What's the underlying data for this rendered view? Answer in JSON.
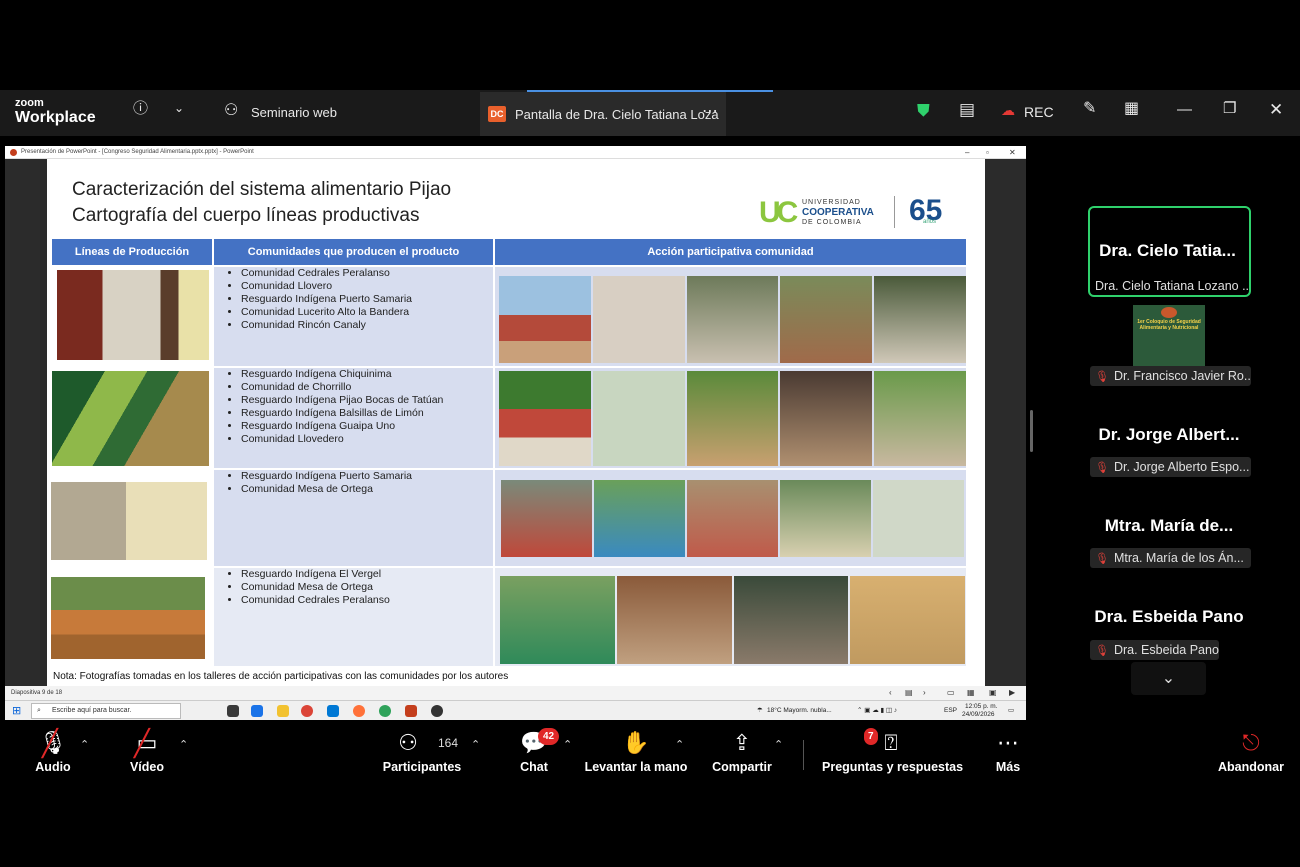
{
  "app": {
    "brand_small": "zoom",
    "brand_big": "Workplace"
  },
  "titlebar": {
    "webinar_label": "Seminario web",
    "share_badge": "DC",
    "share_tab_label": "Pantalla de Dra. Cielo Tatiana Loza",
    "rec_label": "REC"
  },
  "ppt": {
    "window_title": "Presentación de PowerPoint - [Congreso Seguridad Alimentaria.pptx.pptx] - PowerPoint",
    "status_left": "Diapositiva 9 de 18"
  },
  "slide": {
    "title_line1": "Caracterización del sistema alimentario Pijao",
    "title_line2": "Cartografía del cuerpo líneas productivas",
    "logo_univ_top": "UNIVERSIDAD",
    "logo_univ_main": "COOPERATIVA",
    "logo_univ_bottom": "DE COLOMBIA",
    "logo_65": "65",
    "logo_anos": "años",
    "headers": [
      "Líneas de Producción",
      "Comunidades que producen el producto",
      "Acción participativa comunidad"
    ],
    "rows": [
      {
        "communities": [
          "Comunidad Cedrales Peralanso",
          "Comunidad Llovero",
          "Resguardo Indígena Puerto Samaria",
          "Comunidad Lucerito Alto la Bandera",
          "Comunidad Rincón Canaly"
        ]
      },
      {
        "communities": [
          "Resguardo Indígena Chiquinima",
          "Comunidad de Chorrillo",
          "Resguardo Indígena Pijao Bocas de Tatúan",
          "Resguardo Indígena Balsillas de Limón",
          "Resguardo Indígena Guaipa Uno",
          "Comunidad Llovedero"
        ]
      },
      {
        "communities": [
          "Resguardo Indígena Puerto Samaria",
          "Comunidad Mesa de Ortega"
        ]
      },
      {
        "communities": [
          "Resguardo Indígena El Vergel",
          "Comunidad Mesa de Ortega",
          "Comunidad Cedrales Peralanso"
        ]
      }
    ],
    "note": "Nota: Fotografías tomadas en los talleres de acción participativas con las comunidades por los autores"
  },
  "taskbar": {
    "search_placeholder": "Escribe aquí para buscar.",
    "weather": "18°C  Mayorm. nubla...",
    "lang": "ESP",
    "time": "12:05 p. m.",
    "date": "24/09/2026"
  },
  "participants": [
    {
      "big": "Dra. Cielo Tatia...",
      "label": "Dra. Cielo Tatiana Lozano ..."
    },
    {
      "label": "Dr. Francisco Javier Ro..."
    },
    {
      "big": "Dr. Jorge Albert...",
      "label": "Dr. Jorge Alberto Espo..."
    },
    {
      "big": "Mtra. María de...",
      "label": "Mtra. María de los Án..."
    },
    {
      "big": "Dra. Esbeida Pano",
      "label": "Dra. Esbeida Pano"
    }
  ],
  "poster_text": "1er Coloquio de Seguridad Alimentaria y Nutricional",
  "toolbar": {
    "audio": "Audio",
    "video": "Vídeo",
    "participants": "Participantes",
    "participants_count": "164",
    "chat": "Chat",
    "chat_badge": "42",
    "raise_hand": "Levantar la mano",
    "share": "Compartir",
    "qa": "Preguntas y respuestas",
    "qa_badge": "7",
    "more": "Más",
    "leave": "Abandonar"
  },
  "colors": {
    "accent_green": "#2fd16c",
    "header_blue": "#4472c4",
    "alert_red": "#e02828"
  }
}
